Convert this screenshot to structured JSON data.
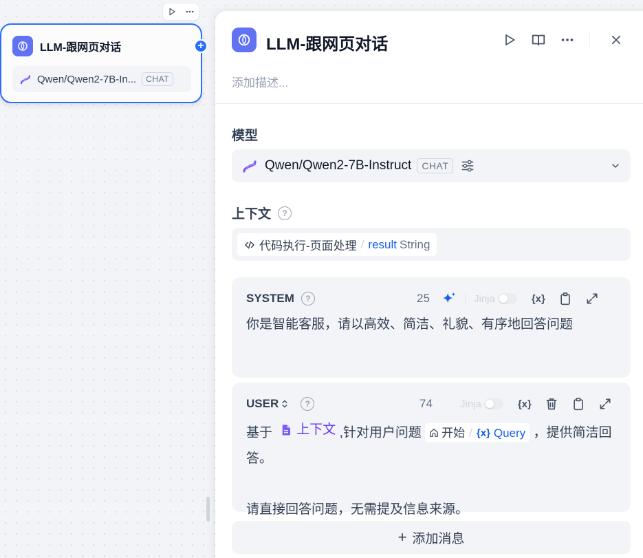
{
  "node": {
    "title": "LLM-跟网页对话",
    "model": "Qwen/Qwen2-7B-In...",
    "badge": "CHAT"
  },
  "panel": {
    "title": "LLM-跟网页对话",
    "description_placeholder": "添加描述...",
    "model_section": {
      "label": "模型",
      "model_name": "Qwen/Qwen2-7B-Instruct",
      "badge": "CHAT"
    },
    "context_section": {
      "label": "上下文",
      "node_name": "代码执行-页面处理",
      "var_name": "result",
      "var_type": "String"
    },
    "system_prompt": {
      "role": "SYSTEM",
      "token_count": "25",
      "jinja_label": "Jinja",
      "var_button": "{x}",
      "text": "你是智能客服，请以高效、简洁、礼貌、有序地回答问题"
    },
    "user_prompt": {
      "role": "USER",
      "token_count": "74",
      "jinja_label": "Jinja",
      "var_button": "{x}",
      "text_prefix": "基于",
      "context_tag": "上下文",
      "text_mid": ",针对用户问题",
      "var_node": "开始",
      "var_icon": "{x}",
      "var_name": "Query",
      "text_suffix": "，提供简洁回答。",
      "text_line2": "请直接回答问题，无需提及信息来源。"
    },
    "add_message_label": "添加消息"
  },
  "colors": {
    "accent": "#296dff",
    "llm_icon_bg": "#6172f3",
    "context_purple": "#6938ef",
    "link_blue": "#155eef"
  }
}
